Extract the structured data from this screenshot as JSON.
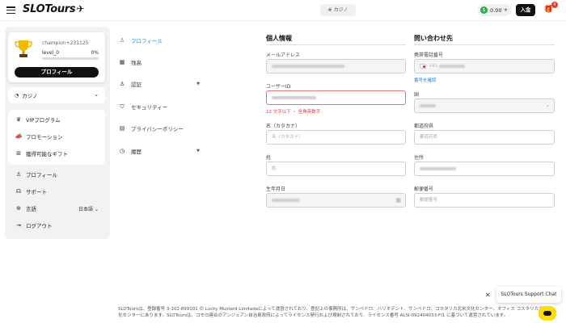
{
  "header": {
    "logo_text": "SLOTours",
    "center_tab": "カジノ",
    "balance": "0.00",
    "deposit_label": "入金",
    "gift_badge": "4"
  },
  "sidebar": {
    "username": "champion+231125",
    "level": "level_0",
    "level_pct": "0%",
    "level_progress": 0,
    "profile_button": "プロフィール",
    "casino_label": "カジノ",
    "menu": [
      {
        "label": "VIPプログラム",
        "icon": "crown-icon"
      },
      {
        "label": "プロモーション",
        "icon": "megaphone-icon"
      },
      {
        "label": "獲得可能なギフト",
        "icon": "gift-icon"
      }
    ],
    "lower": [
      {
        "label": "プロフィール",
        "icon": "user-icon"
      },
      {
        "label": "サポート",
        "icon": "headset-icon"
      },
      {
        "label": "言語",
        "icon": "globe-icon",
        "value": "日本語"
      },
      {
        "label": "ログアウト",
        "icon": "logout-icon"
      }
    ]
  },
  "settings_nav": [
    {
      "label": "プロフィール",
      "icon": "user-icon",
      "active": true
    },
    {
      "label": "残高",
      "icon": "wallet-icon"
    },
    {
      "label": "認証",
      "icon": "verify-icon",
      "expandable": true
    },
    {
      "label": "セキュリティー",
      "icon": "shield-icon"
    },
    {
      "label": "プライバシーポリシー",
      "icon": "document-icon"
    },
    {
      "label": "履歴",
      "icon": "history-icon",
      "expandable": true
    }
  ],
  "personal": {
    "title": "個人情報",
    "email_label": "メールアドレス",
    "userid_label": "ユーザーID",
    "userid_error": "12 文字以下 ・ 全角英数字",
    "firstname_label": "名（カタカナ）",
    "firstname_placeholder": "名（カタカナ）",
    "lastname_label": "姓",
    "lastname_placeholder": "姓",
    "birthdate_label": "生年月日"
  },
  "contact": {
    "title": "問い合わせ先",
    "phone_label": "携帯電話番号",
    "phone_prefix": "+81",
    "phone_link": "番号を確認",
    "country_label": "国",
    "prefecture_label": "都道府県",
    "prefecture_placeholder": "都道府県",
    "address_label": "住所",
    "postal_label": "郵便番号",
    "postal_placeholder": "郵便番号"
  },
  "footer": {
    "text": "SLOToursは、登録番号 3-102-899101 の Lucky Mustard Limitadaによって運営されており、登記上の事務所は、サンペドロ、バリオデント、サンペドロ、コスタリカ北米文化センター、オフィス コスタリカ北米文化センターにあります。SLOToursは、コモロ連合のアンジュアン自治島政府によってライセンス発行および規制されており、ライセンス番号 ALSI-092404033-FI1 に基づいて運営されています。"
  },
  "support": {
    "chat_label": "SLOTours Support Chat",
    "close_symbol": "✕"
  }
}
